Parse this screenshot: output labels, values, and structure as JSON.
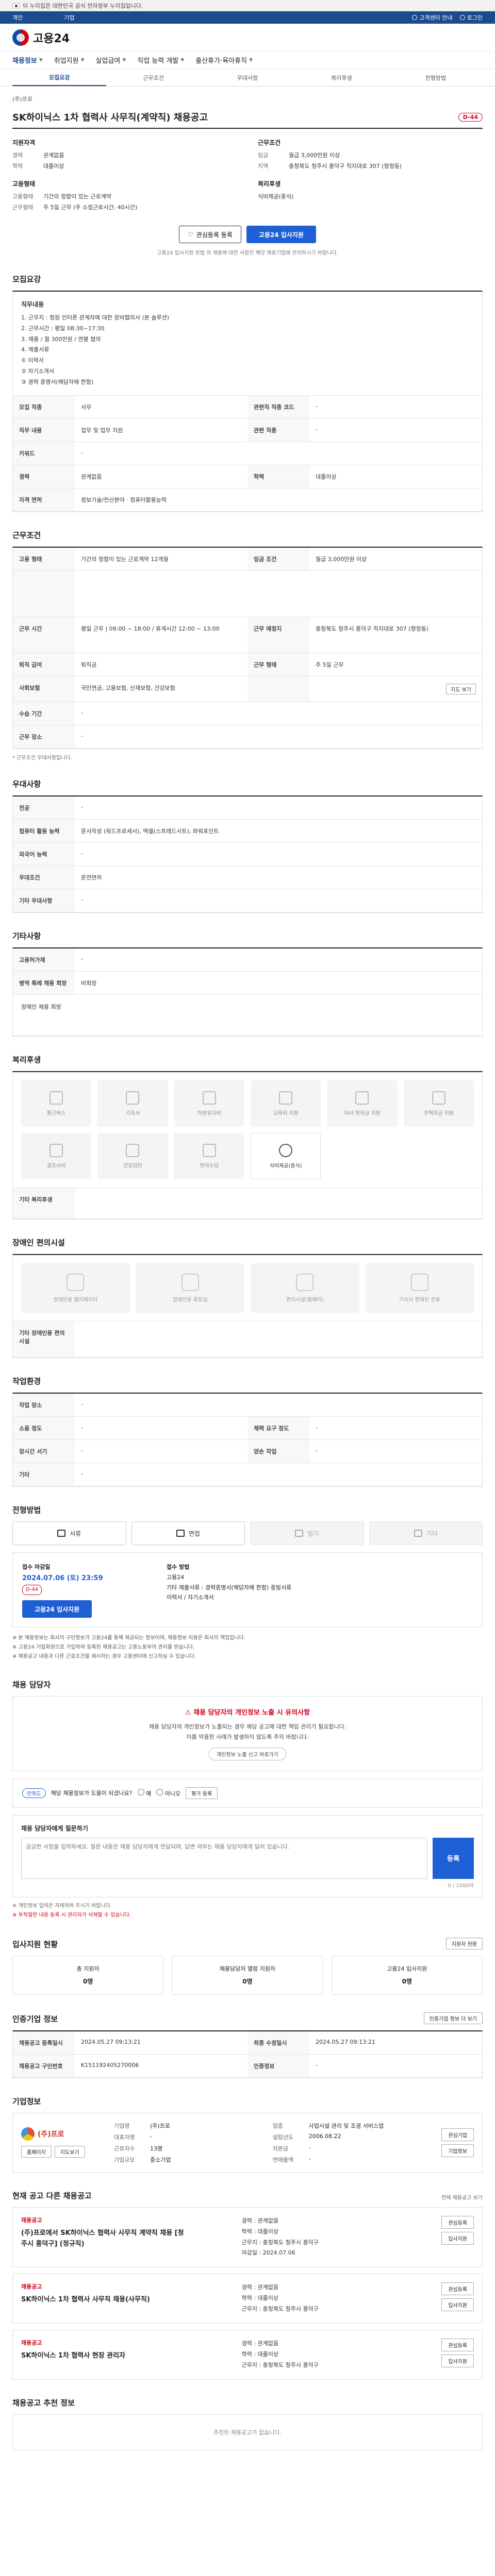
{
  "gov_banner": "이 누리집은 대한민국 공식 전자정부 누리집입니다.",
  "topstrip": {
    "left_items": [
      "개인",
      "기업"
    ],
    "right_items": [
      "고객센터 안내",
      "로그인"
    ]
  },
  "logo_text": "고용24",
  "nav": [
    "채용정보",
    "취업지원",
    "실업급여",
    "직업 능력 개발",
    "출산휴가·육아휴직"
  ],
  "tabs": [
    "모집요강",
    "근무조건",
    "우대사항",
    "복리후생",
    "전형방법"
  ],
  "job": {
    "company": "(주)프로",
    "title": "SK하이닉스 1차 협력사 사무직(계약직) 채용공고",
    "dday": "D-44"
  },
  "summary": {
    "left_title": "지원자격",
    "left_rows": [
      {
        "k": "경력",
        "v": "관계없음"
      },
      {
        "k": "학력",
        "v": "대졸이상"
      }
    ],
    "left_title2": "고용형태",
    "left_rows2": [
      {
        "k": "고용형태",
        "v": "기간의 정함이 있는 근로계약"
      },
      {
        "k": "근무형태",
        "v": "주 5일 근무 (주 소정근로시간: 40시간)"
      }
    ],
    "right_title": "근무조건",
    "right_rows": [
      {
        "k": "임금",
        "v": "월급 3,000만원 이상"
      },
      {
        "k": "지역",
        "v": "충청북도 청주시 흥덕구 직지대로 307 (향정동)"
      }
    ],
    "right_title2": "복리후생",
    "right_rows2": [
      {
        "k": "",
        "v": "식비제공(중식)"
      }
    ]
  },
  "actions": {
    "bookmark": "관심등록 등록",
    "apply": "고용24 입사지원",
    "note": "고용24 입사지원 방법 외 채용에 대한 사항은 해당 채용기업에 문의하시기 바랍니다."
  },
  "sections": {
    "recruit": "모집요강",
    "work": "근무조건",
    "prefer": "우대사항",
    "other": "기타사항",
    "welfare": "복리후생",
    "disability": "장애인 편의시설",
    "environment": "작업환경",
    "method": "전형방법",
    "report": "채용 담당자",
    "inquiry": "채용 담당자에게 질문하기",
    "progress": "입사지원 현황",
    "info": "인증기업 정보",
    "corp": "기업정보",
    "others": "현재 공고 다른 채용공고",
    "recommend": "채용공고 추천 정보"
  },
  "recruit": {
    "desc_title": "직무내용",
    "desc_lines": [
      "1. 근무지 : 청원 인터폰 관계자에 대한 장비협의사 (본 솔루션)",
      "2. 근무시간 : 평일 08:30~17:30",
      "3. 채용 / 월 300만원 / 연봉 협의",
      "4. 제출서류",
      "  ① 이력서",
      "  ② 자기소개서",
      "  ③ 경력 증명서(해당자에 한함)"
    ],
    "rows": [
      [
        "모집 직종",
        "사무",
        "관련직 직종 코드",
        "-"
      ],
      [
        "직무 내용",
        "업무 및 업무 지원",
        "관련 직종",
        "-"
      ],
      [
        "키워드",
        "-",
        "",
        ""
      ],
      [
        "경력",
        "관계없음",
        "학력",
        "대졸이상"
      ],
      [
        "자격 면허",
        "정보기술/전산분야 · 컴퓨터활용능력",
        "",
        ""
      ]
    ]
  },
  "work": {
    "rows": [
      [
        "고용 형태",
        "기간의 정함이 있는 근로계약 12개월",
        "임금 조건",
        "월급 3,000만원 이상"
      ],
      [
        "",
        "",
        "",
        ""
      ],
      [
        "근무 시간",
        "평일 근무  |  09:00 ~ 18:00 / 휴게시간 12:00 ~ 13:00",
        "근무 예정지",
        "충청북도 청주시 흥덕구 직지대로 307 (향정동)"
      ],
      [
        "퇴직 급여",
        "퇴직금",
        "근무 형태",
        "주 5일 근무"
      ],
      [
        "사회보험",
        "국민연금, 고용보험, 산재보험, 건강보험",
        "",
        ""
      ],
      [
        "수습 기간",
        "-",
        "",
        ""
      ],
      [
        "근무 장소",
        "-",
        "",
        ""
      ]
    ],
    "note": "* 근무조건 우대사항입니다.",
    "more": "지도 보기"
  },
  "prefer": {
    "rows": [
      [
        "전공",
        "-"
      ],
      [
        "컴퓨터 활용 능력",
        "문서작성 (워드프로세서), 엑셀(스프레드시트), 파워포인트"
      ],
      [
        "외국어 능력",
        "-"
      ],
      [
        "우대조건",
        "운전면허"
      ],
      [
        "기타 우대사항",
        "-"
      ]
    ]
  },
  "other": {
    "rows": [
      [
        "고용허가제",
        "-"
      ],
      [
        "병역 특례 채용 희망",
        "비희망"
      ]
    ],
    "extra": "장애인 채용 희망"
  },
  "welfare": {
    "items": [
      "통근버스",
      "기숙사",
      "차량유지비",
      "교육비 지원",
      "자녀 학자금 지원",
      "주택자금 지원",
      "경조사비",
      "건강검진",
      "연차수당",
      "식비제공(중식)"
    ],
    "active_index": 9,
    "extra_label": "기타 복리후생"
  },
  "disability": {
    "items": [
      "장애인용 엘리베이터",
      "장애인용 화장실",
      "편의시설(휠체어)",
      "기숙사 장애인 전용"
    ],
    "extra_label": "기타 장애인용 편의시설"
  },
  "environment": {
    "rows": [
      [
        "작업 장소",
        "-",
        "",
        ""
      ],
      [
        "소음 정도",
        "-",
        "체력 요구 정도",
        "-"
      ],
      [
        "장시간 서기",
        "-",
        "양손 작업",
        "-"
      ],
      [
        "기타",
        "-",
        "",
        ""
      ]
    ]
  },
  "method": {
    "items": [
      "서류",
      "면접",
      "필기",
      "기타"
    ],
    "active": [
      true,
      true,
      false,
      false
    ],
    "deadline_label": "접수 마감일",
    "deadline": "2024.07.06 (토) 23:59",
    "dday": "D-44",
    "apply_btn": "고용24 입사지원",
    "doc_label": "접수 방법",
    "doc_lines": [
      "고용24",
      "기타 제출서류 : 경력증명서(해당자에 한함) 증빙서류",
      "이력서 / 자기소개서"
    ]
  },
  "long_notes": [
    "※ 본 채용정보는 회사의 구인정보가 고용24를 통해 제공되는 정보이며, 채용정보 이용은 회사의 책임입니다.",
    "※ 고용24 기업회원으로 가입하여 등록된 채용공고는 고용노동부의 관리를 받습니다.",
    "※ 채용공고 내용과 다른 근로조건을 제시하는 경우 고용센터에 신고하실 수 있습니다."
  ],
  "report": {
    "title": "채용 담당자의 개인정보 노출 시 유의사항",
    "lines": [
      "채용 담당자의 개인정보가 노출되는 경우 해당 공고에 대한 책임 관리가 필요합니다.",
      "이를 악용한 사례가 발생하지 않도록 주의 바랍니다."
    ],
    "link": "개인정보 노출 신고 바로가기"
  },
  "survey": {
    "pill": "만족도",
    "text": "해당 채용정보가 도움이 되셨나요?",
    "options": [
      "예",
      "아니오"
    ],
    "submit": "평가 등록"
  },
  "inquiry": {
    "label": "채용 담당자에게 질문하기",
    "placeholder": "궁금한 사항을 입력하세요. 질문 내용은 채용 담당자에게 전달되며, 답변 여부는 채용 담당자에게 달려 있습니다.",
    "count": "0 / 1000자",
    "submit": "등록",
    "notes": [
      "※ 개인정보 입력은 자제하여 주시기 바랍니다.",
      "※ 부적절한 내용 등록 시 관리자가 삭제할 수 있습니다."
    ]
  },
  "progress": {
    "items": [
      {
        "label": "총 지원자",
        "value": "0명"
      },
      {
        "label": "채용담당자 열람 지원자",
        "value": "0명"
      },
      {
        "label": "고용24 입사지원",
        "value": "0명"
      }
    ],
    "more": "지원자 현황"
  },
  "cert": {
    "more": "인증기업 정보 더 보기",
    "rows": [
      [
        "채용공고 등록일시",
        "2024.05.27 09:13:21",
        "최종 수정일시",
        "2024.05.27 09:13:21"
      ],
      [
        "채용공고 구인번호",
        "K151192405270006",
        "인증정보",
        "-"
      ]
    ]
  },
  "corp": {
    "name": "(주)프로",
    "grid": [
      [
        "기업명",
        "(주)프로",
        "업종",
        "사업시설 관리 및 조경 서비스업"
      ],
      [
        "대표자명",
        "-",
        "설립년도",
        "2006.08.22"
      ],
      [
        "근로자수",
        "13명",
        "자본금",
        "-"
      ],
      [
        "기업규모",
        "중소기업",
        "연매출액",
        "-"
      ]
    ],
    "btns": [
      "관심기업",
      "기업정보"
    ],
    "tags": [
      "홈페이지",
      "지도보기"
    ]
  },
  "others": {
    "more": "전체 채용공고 보기",
    "items": [
      {
        "tag": "채용공고",
        "title": "(주)프로에서 SK하이닉스 협력사 사무직 계약직 채용 [청주시 흥덕구] (정규직)",
        "lines": [
          "경력 : 관계없음",
          "학력 : 대졸이상",
          "근무지 : 충청북도 청주시 흥덕구",
          "마감일 : 2024.07.06"
        ],
        "btns": [
          "관심등록",
          "입사지원"
        ]
      },
      {
        "tag": "채용공고",
        "title": "SK하이닉스 1차 협력사 사무직 채용(사무직)",
        "lines": [
          "경력 : 관계없음",
          "학력 : 대졸이상",
          "근무지 : 충청북도 청주시 흥덕구"
        ],
        "btns": [
          "관심등록",
          "입사지원"
        ]
      },
      {
        "tag": "채용공고",
        "title": "SK하이닉스 1차 협력사 현장 관리자",
        "lines": [
          "경력 : 관계없음",
          "학력 : 대졸이상",
          "근무지 : 충청북도 청주시 흥덕구"
        ],
        "btns": [
          "관심등록",
          "입사지원"
        ]
      }
    ]
  },
  "recommend": {
    "empty": "추천된 채용공고가 없습니다."
  }
}
